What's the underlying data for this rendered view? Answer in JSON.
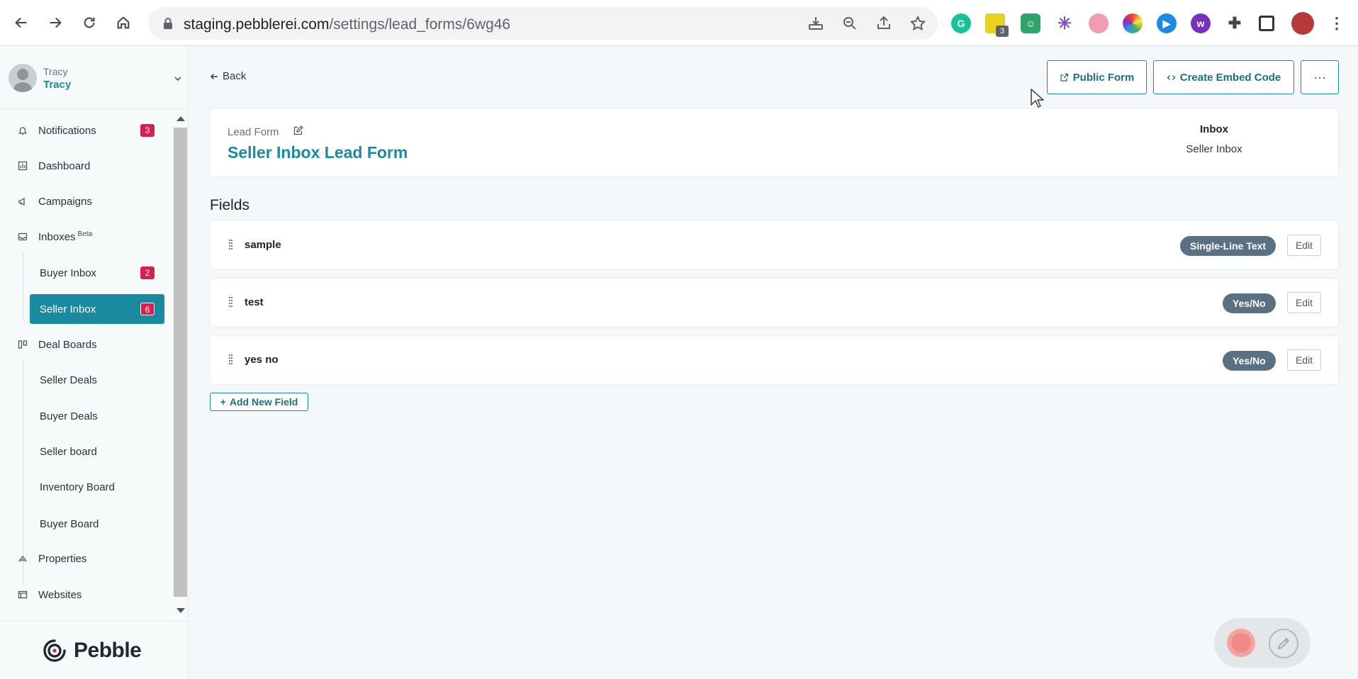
{
  "browser": {
    "url_host": "staging.pebblerei.com",
    "url_path": "/settings/lead_forms/6wg46",
    "extension_badge": "3",
    "extension_icons": [
      "grammarly-icon",
      "notes-extension-icon",
      "robot-extension-icon",
      "asterisk-extension-icon",
      "bubble-extension-icon",
      "color-wheel-extension-icon",
      "arrow-extension-icon",
      "w-extension-icon",
      "puzzle-icon",
      "side-panel-icon",
      "profile-avatar-icon",
      "more-icon"
    ]
  },
  "user": {
    "small_name": "Tracy",
    "name": "Tracy"
  },
  "sidebar": {
    "items": [
      {
        "label": "Notifications",
        "icon": "bell-icon",
        "badge": "3"
      },
      {
        "label": "Dashboard",
        "icon": "dashboard-icon"
      },
      {
        "label": "Campaigns",
        "icon": "megaphone-icon"
      },
      {
        "label": "Inboxes",
        "icon": "inbox-icon",
        "tag": "Beta"
      },
      {
        "label": "Deal Boards",
        "icon": "board-icon"
      },
      {
        "label": "Properties",
        "icon": "home-icon"
      },
      {
        "label": "Websites",
        "icon": "browser-icon"
      }
    ],
    "inbox_subitems": [
      {
        "label": "Buyer Inbox",
        "badge": "2"
      },
      {
        "label": "Seller Inbox",
        "badge": "6",
        "active": true
      }
    ],
    "deal_subitems": [
      {
        "label": "Seller Deals"
      },
      {
        "label": "Buyer Deals"
      },
      {
        "label": "Seller board"
      },
      {
        "label": "Inventory Board"
      },
      {
        "label": "Buyer Board"
      }
    ],
    "logo_text": "Pebble"
  },
  "toolbar": {
    "back_label": "Back",
    "public_form_label": "Public Form",
    "embed_label": "Create Embed Code",
    "more_label": "···"
  },
  "lead_form": {
    "label": "Lead Form",
    "title": "Seller Inbox Lead Form",
    "inbox_heading": "Inbox",
    "inbox_value": "Seller Inbox"
  },
  "fields": {
    "title": "Fields",
    "rows": [
      {
        "name": "sample",
        "type": "Single-Line Text",
        "edit_label": "Edit"
      },
      {
        "name": "test",
        "type": "Yes/No",
        "edit_label": "Edit"
      },
      {
        "name": "yes no",
        "type": "Yes/No",
        "edit_label": "Edit"
      }
    ],
    "add_label": "Add New Field"
  },
  "colors": {
    "accent": "#1a8aa0",
    "badge": "#d6204e",
    "pill": "#5a7083"
  }
}
